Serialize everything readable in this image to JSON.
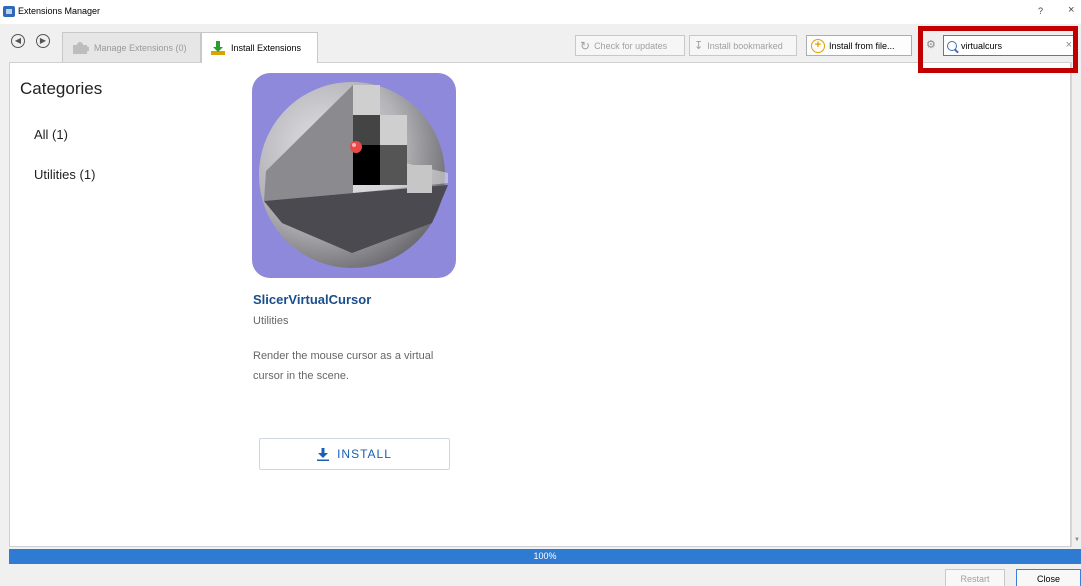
{
  "window": {
    "title": "Extensions Manager",
    "help": "?",
    "close": "×"
  },
  "toolbar": {
    "back_icon": "arrow-left-circle",
    "forward_icon": "arrow-right-circle",
    "tabs": [
      {
        "label": "Manage Extensions (0)",
        "active": false
      },
      {
        "label": "Install Extensions",
        "active": true
      }
    ],
    "check_updates": "Check for updates",
    "install_bookmarked": "Install bookmarked",
    "install_from_file": "Install from file...",
    "search": {
      "value": "virtualcurs",
      "clear": "×"
    }
  },
  "sidebar": {
    "title": "Categories",
    "items": [
      {
        "label": "All (1)"
      },
      {
        "label": "Utilities (1)"
      }
    ]
  },
  "extension": {
    "name": "SlicerVirtualCursor",
    "category": "Utilities",
    "description": "Render the mouse cursor as a virtual cursor in the scene.",
    "install_label": "INSTALL"
  },
  "progress": {
    "value": 1.0,
    "label": "100%"
  },
  "buttons": {
    "restart": "Restart",
    "close": "Close"
  },
  "colors": {
    "accent": "#2f7bd1",
    "title": "#1a4d8c",
    "highlight": "#c00000"
  }
}
